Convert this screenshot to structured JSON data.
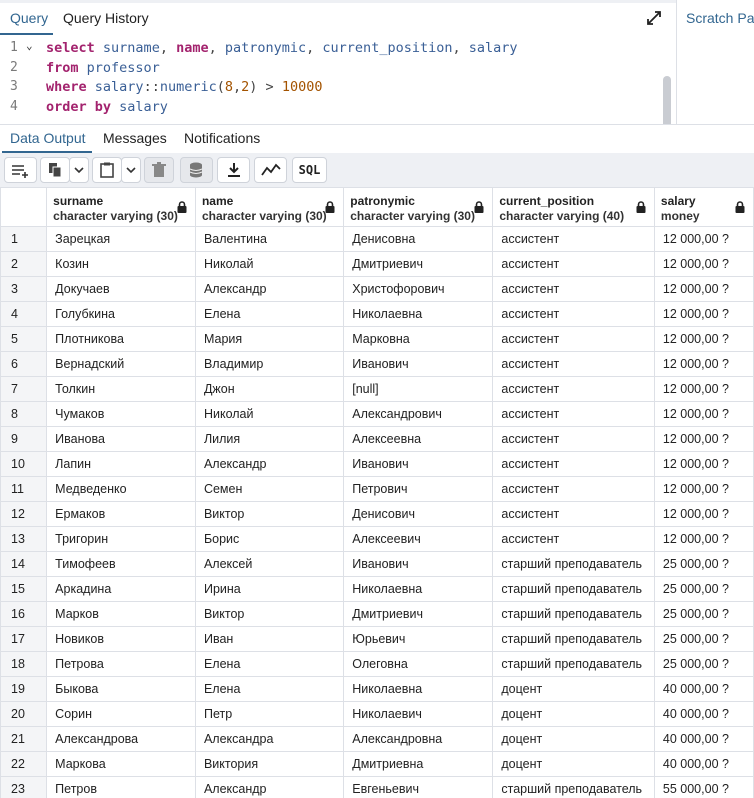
{
  "top_tabs": {
    "query": "Query",
    "history": "Query History"
  },
  "scratch": {
    "label": "Scratch Pa"
  },
  "editor": {
    "line_numbers": [
      "1",
      "2",
      "3",
      "4"
    ],
    "lines": [
      [
        {
          "t": "select",
          "c": "kw"
        },
        {
          "t": " ",
          "c": "op"
        },
        {
          "t": "surname",
          "c": "id"
        },
        {
          "t": ", ",
          "c": "op"
        },
        {
          "t": "name",
          "c": "kw"
        },
        {
          "t": ", ",
          "c": "op"
        },
        {
          "t": "patronymic",
          "c": "id"
        },
        {
          "t": ", ",
          "c": "op"
        },
        {
          "t": "current_position",
          "c": "id"
        },
        {
          "t": ", ",
          "c": "op"
        },
        {
          "t": "salary",
          "c": "id"
        }
      ],
      [
        {
          "t": "from",
          "c": "kw"
        },
        {
          "t": " ",
          "c": "op"
        },
        {
          "t": "professor",
          "c": "id"
        }
      ],
      [
        {
          "t": "where",
          "c": "kw"
        },
        {
          "t": " ",
          "c": "op"
        },
        {
          "t": "salary",
          "c": "id"
        },
        {
          "t": "::",
          "c": "op"
        },
        {
          "t": "numeric",
          "c": "id"
        },
        {
          "t": "(",
          "c": "op"
        },
        {
          "t": "8",
          "c": "num-lit"
        },
        {
          "t": ",",
          "c": "op"
        },
        {
          "t": "2",
          "c": "num-lit"
        },
        {
          "t": ") > ",
          "c": "op"
        },
        {
          "t": "10000",
          "c": "num-lit"
        }
      ],
      [
        {
          "t": "order by",
          "c": "kw"
        },
        {
          "t": " ",
          "c": "op"
        },
        {
          "t": "salary",
          "c": "id"
        }
      ]
    ]
  },
  "result_tabs": {
    "data_output": "Data Output",
    "messages": "Messages",
    "notifications": "Notifications"
  },
  "toolbar": {
    "sql_label": "SQL"
  },
  "columns": [
    {
      "name": "surname",
      "type": "character varying (30)"
    },
    {
      "name": "name",
      "type": "character varying (30)"
    },
    {
      "name": "patronymic",
      "type": "character varying (30)"
    },
    {
      "name": "current_position",
      "type": "character varying (40)"
    },
    {
      "name": "salary",
      "type": "money"
    }
  ],
  "rows": [
    [
      "1",
      "Зарецкая",
      "Валентина",
      "Денисовна",
      "ассистент",
      "12 000,00 ?"
    ],
    [
      "2",
      "Козин",
      "Николай",
      "Дмитриевич",
      "ассистент",
      "12 000,00 ?"
    ],
    [
      "3",
      "Докучаев",
      "Александр",
      "Христофорович",
      "ассистент",
      "12 000,00 ?"
    ],
    [
      "4",
      "Голубкина",
      "Елена",
      "Николаевна",
      "ассистент",
      "12 000,00 ?"
    ],
    [
      "5",
      "Плотникова",
      "Мария",
      "Марковна",
      "ассистент",
      "12 000,00 ?"
    ],
    [
      "6",
      "Вернадский",
      "Владимир",
      "Иванович",
      "ассистент",
      "12 000,00 ?"
    ],
    [
      "7",
      "Толкин",
      "Джон",
      "[null]",
      "ассистент",
      "12 000,00 ?"
    ],
    [
      "8",
      "Чумаков",
      "Николай",
      "Александрович",
      "ассистент",
      "12 000,00 ?"
    ],
    [
      "9",
      "Иванова",
      "Лилия",
      "Алексеевна",
      "ассистент",
      "12 000,00 ?"
    ],
    [
      "10",
      "Лапин",
      "Александр",
      "Иванович",
      "ассистент",
      "12 000,00 ?"
    ],
    [
      "11",
      "Медведенко",
      "Семен",
      "Петрович",
      "ассистент",
      "12 000,00 ?"
    ],
    [
      "12",
      "Ермаков",
      "Виктор",
      "Денисович",
      "ассистент",
      "12 000,00 ?"
    ],
    [
      "13",
      "Тригорин",
      "Борис",
      "Алексеевич",
      "ассистент",
      "12 000,00 ?"
    ],
    [
      "14",
      "Тимофеев",
      "Алексей",
      "Иванович",
      "старший преподаватель",
      "25 000,00 ?"
    ],
    [
      "15",
      "Аркадина",
      "Ирина",
      "Николаевна",
      "старший преподаватель",
      "25 000,00 ?"
    ],
    [
      "16",
      "Марков",
      "Виктор",
      "Дмитриевич",
      "старший преподаватель",
      "25 000,00 ?"
    ],
    [
      "17",
      "Новиков",
      "Иван",
      "Юрьевич",
      "старший преподаватель",
      "25 000,00 ?"
    ],
    [
      "18",
      "Петрова",
      "Елена",
      "Олеговна",
      "старший преподаватель",
      "25 000,00 ?"
    ],
    [
      "19",
      "Быкова",
      "Елена",
      "Николаевна",
      "доцент",
      "40 000,00 ?"
    ],
    [
      "20",
      "Сорин",
      "Петр",
      "Николаевич",
      "доцент",
      "40 000,00 ?"
    ],
    [
      "21",
      "Александрова",
      "Александра",
      "Александровна",
      "доцент",
      "40 000,00 ?"
    ],
    [
      "22",
      "Маркова",
      "Виктория",
      "Дмитриевна",
      "доцент",
      "40 000,00 ?"
    ],
    [
      "23",
      "Петров",
      "Александр",
      "Евгеньевич",
      "старший преподаватель",
      "55 000,00 ?"
    ]
  ],
  "colors": {
    "accent": "#326690",
    "keyword": "#a3236e",
    "identifier": "#3a5f96",
    "number": "#a35300"
  }
}
